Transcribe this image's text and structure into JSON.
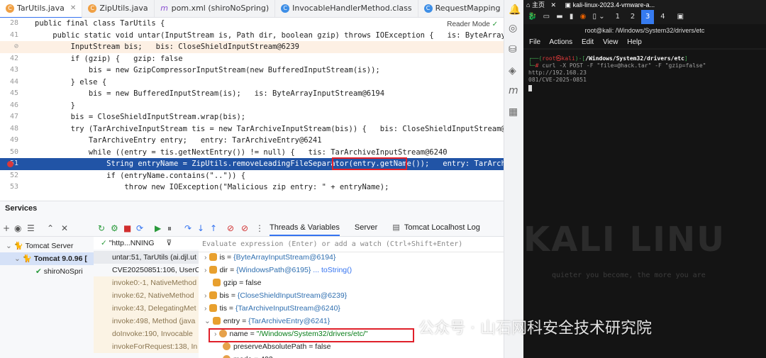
{
  "editor_tabs": [
    {
      "label": "TarUtils.java",
      "icon": "java-class-icon",
      "active": true
    },
    {
      "label": "ZipUtils.java",
      "icon": "java-class-icon",
      "active": false
    },
    {
      "label": "pom.xml (shiroNoSpring)",
      "icon": "maven-icon",
      "active": false
    },
    {
      "label": "InvocableHandlerMethod.class",
      "icon": "class-file-icon",
      "active": false
    },
    {
      "label": "RequestMapping",
      "icon": "class-file-icon",
      "active": false
    }
  ],
  "reader_mode": "Reader Mode",
  "code_lines": [
    {
      "n": "28",
      "t": "public final class TarUtils {"
    },
    {
      "n": "41",
      "t": "    public static void untar(InputStream is, Path dir, boolean gzip) throws IOException {   is: ByteArrayInputStream"
    },
    {
      "n": "",
      "t": "        InputStream bis;   bis: CloseShieldInputStream@6239"
    },
    {
      "n": "42",
      "t": "        if (gzip) {   gzip: false"
    },
    {
      "n": "43",
      "t": "            bis = new GzipCompressorInputStream(new BufferedInputStream(is));"
    },
    {
      "n": "44",
      "t": "        } else {"
    },
    {
      "n": "45",
      "t": "            bis = new BufferedInputStream(is);   is: ByteArrayInputStream@6194"
    },
    {
      "n": "46",
      "t": "        }"
    },
    {
      "n": "47",
      "t": "        bis = CloseShieldInputStream.wrap(bis);"
    },
    {
      "n": "48",
      "t": "        try (TarArchiveInputStream tis = new TarArchiveInputStream(bis)) {   bis: CloseShieldInputStream@6239"
    },
    {
      "n": "49",
      "t": "            TarArchiveEntry entry;   entry: TarArchiveEntry@6241"
    },
    {
      "n": "50",
      "t": "            while ((entry = tis.getNextEntry()) != null) {   tis: TarArchiveInputStream@6240"
    },
    {
      "n": "51",
      "t": "                String entryName = ZipUtils.removeLeadingFileSeparator(entry.getName());   entry: TarArchiveEntry"
    },
    {
      "n": "52",
      "t": "                if (entryName.contains(\"..\")) {"
    },
    {
      "n": "53",
      "t": "                    throw new IOException(\"Malicious zip entry: \" + entryName);"
    }
  ],
  "services": {
    "title": "Services",
    "tree": [
      {
        "label": "Tomcat Server"
      },
      {
        "label": "Tomcat 9.0.96 ["
      },
      {
        "label": "shiroNoSpri"
      }
    ],
    "thread_filter": "\"http...NNING",
    "frames": [
      {
        "label": "untar:51, TarUtils (ai.djl.ut"
      },
      {
        "label": "CVE20250851:106, UserC"
      },
      {
        "label": "invoke0:-1, NativeMethod"
      },
      {
        "label": "invoke:62, NativeMethod"
      },
      {
        "label": "invoke:43, DelegatingMet"
      },
      {
        "label": "invoke:498, Method (java"
      },
      {
        "label": "doInvoke:190, Invocable"
      },
      {
        "label": "invokeForRequest:138, In"
      }
    ],
    "tabs": [
      "Threads & Variables",
      "Server",
      "Tomcat Localhost Log"
    ],
    "eval_placeholder": "Evaluate expression (Enter) or add a watch (Ctrl+Shift+Enter)",
    "variables": [
      {
        "name": "is",
        "value": "{ByteArrayInputStream@6194}",
        "link": ""
      },
      {
        "name": "dir",
        "value": "{WindowsPath@6195}",
        "link": "... toString()"
      },
      {
        "name": "gzip",
        "value": "false",
        "link": ""
      },
      {
        "name": "bis",
        "value": "{CloseShieldInputStream@6239}",
        "link": ""
      },
      {
        "name": "tis",
        "value": "{TarArchiveInputStream@6240}",
        "link": ""
      },
      {
        "name": "entry",
        "value": "{TarArchiveEntry@6241}",
        "link": ""
      },
      {
        "name": "name",
        "value": "\"/Windows/System32/drivers/etc/\"",
        "link": ""
      },
      {
        "name": "preserveAbsolutePath",
        "value": "false",
        "link": ""
      },
      {
        "name": "mode",
        "value": "493",
        "link": ""
      }
    ]
  },
  "kali": {
    "vm_tab_home": "主页",
    "vm_tab_title": "kali-linux-2023.4-vmware-a...",
    "workspaces": [
      "1",
      "2",
      "3",
      "4"
    ],
    "window_title": "root@kali: /Windows/System32/drivers/etc",
    "menu": [
      "File",
      "Actions",
      "Edit",
      "View",
      "Help"
    ],
    "prompt_user": "root㉿kali",
    "prompt_path": "/Windows/System32/drivers/etc",
    "command": "curl -X POST -F \"file=@hack.tar\" -F \"gzip=false\" http://192.168.23",
    "command_cont": "081/CVE-2025-0851",
    "bg_text": "KALI LINU",
    "tagline": "quieter you become, the more you are"
  },
  "watermark": "公众号 · 山石网科安全技术研究院",
  "colors": {
    "accent": "#3574f0",
    "highlight_blue": "#2154a6",
    "redbox": "#e0202a",
    "kali_blue": "#367bf0"
  }
}
